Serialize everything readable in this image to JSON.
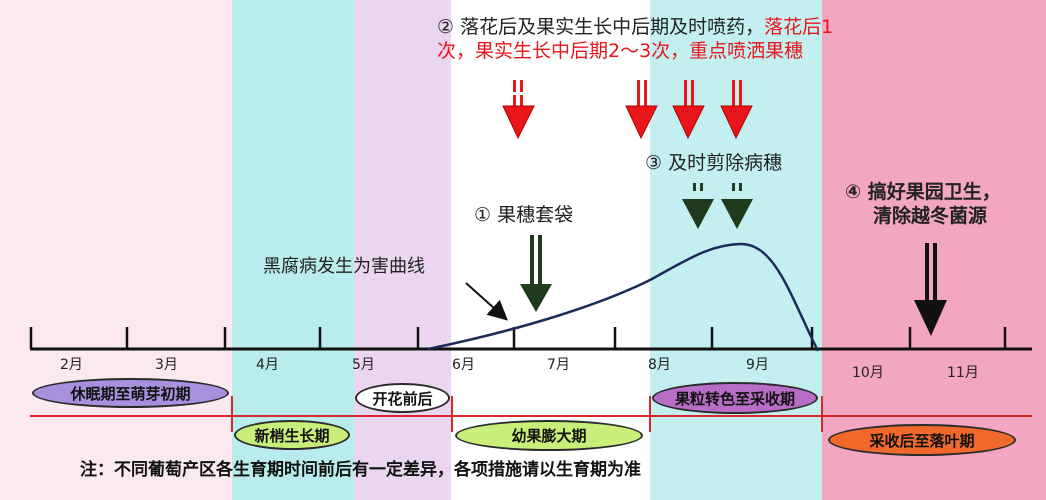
{
  "title_note": "注：不同葡萄产区各生育期时间前后有一定差异，各项措施请以生育期为准",
  "months": [
    "2月",
    "3月",
    "4月",
    "5月",
    "6月",
    "7月",
    "8月",
    "9月",
    "10月",
    "11月"
  ],
  "stages": {
    "dormant": "休眠期至萌芽初期",
    "shoot": "新梢生长期",
    "preflower": "开花前后",
    "fruit_swell": "幼果膨大期",
    "veraison": "果粒转色至采收期",
    "postharvest": "采收后至落叶期"
  },
  "measures": {
    "m1": "① 果穗套袋",
    "m2_line1_a": "② 落花后及果实生长中后期及时喷药，",
    "m2_line1_b": "落花后1",
    "m2_line2": "次，果实生长中后期2～3次，重点喷洒果穗",
    "m3": "③ 及时剪除病穗",
    "m4_line1": "④ 搞好果园卫生，",
    "m4_line2": "清除越冬菌源"
  },
  "curve_label": "黑腐病发生为害曲线",
  "colors": {
    "red": "#e8151b",
    "dark_green": "#1f3a1c",
    "band_pink": "#fbe9f0",
    "band_cyan": "#b9ecec",
    "band_lilac": "#ead6ef",
    "band_rose": "#ef9bb8",
    "pill_lilac": "#a890df",
    "pill_lime": "#c9ef7a",
    "pill_purple": "#b86ec6",
    "pill_orange": "#f0682a"
  }
}
